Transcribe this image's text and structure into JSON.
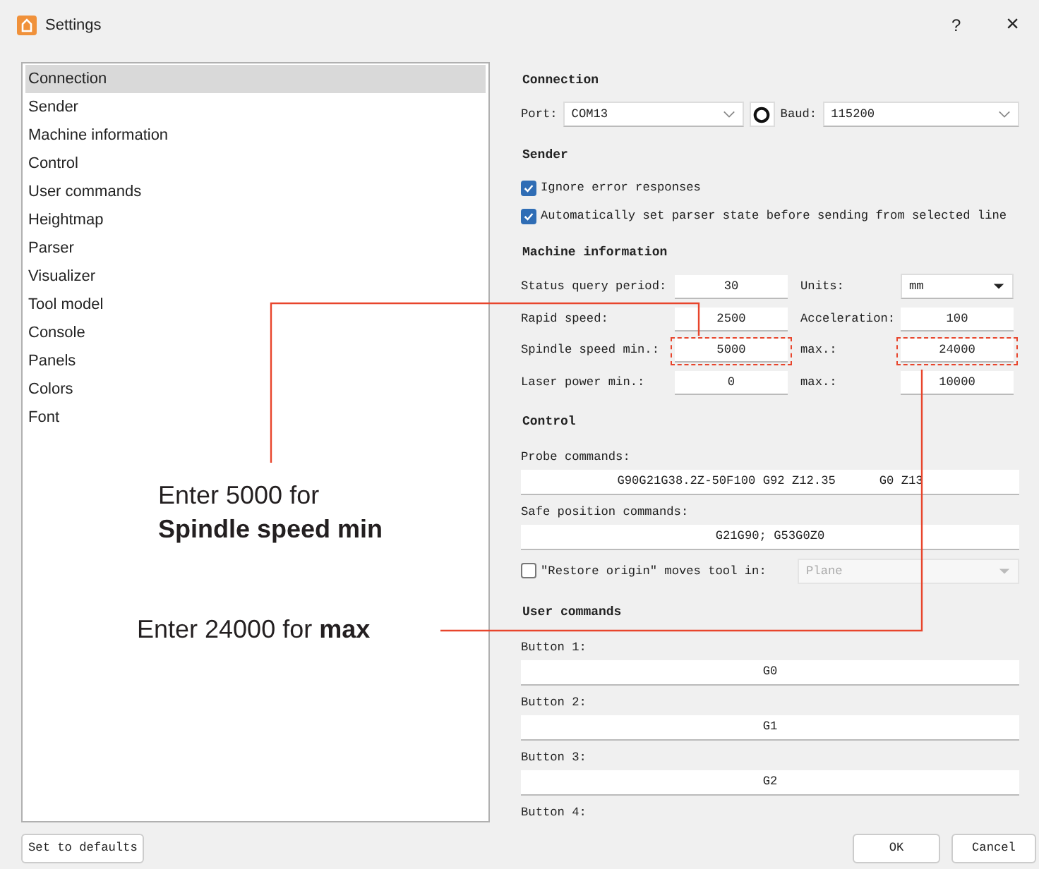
{
  "window": {
    "title": "Settings",
    "help": "?",
    "close": "×"
  },
  "sidebar": {
    "items": [
      {
        "label": "Connection",
        "selected": true
      },
      {
        "label": "Sender",
        "selected": false
      },
      {
        "label": "Machine information",
        "selected": false
      },
      {
        "label": "Control",
        "selected": false
      },
      {
        "label": "User commands",
        "selected": false
      },
      {
        "label": "Heightmap",
        "selected": false
      },
      {
        "label": "Parser",
        "selected": false
      },
      {
        "label": "Visualizer",
        "selected": false
      },
      {
        "label": "Tool model",
        "selected": false
      },
      {
        "label": "Console",
        "selected": false
      },
      {
        "label": "Panels",
        "selected": false
      },
      {
        "label": "Colors",
        "selected": false
      },
      {
        "label": "Font",
        "selected": false
      }
    ]
  },
  "connection": {
    "title": "Connection",
    "port_label": "Port:",
    "port": "COM13",
    "baud_label": "Baud:",
    "baud": "115200"
  },
  "sender": {
    "title": "Sender",
    "options": [
      {
        "label": "Ignore error responses",
        "checked": true
      },
      {
        "label": "Automatically set parser state before sending from selected line",
        "checked": true
      }
    ]
  },
  "machine_information": {
    "title": "Machine information",
    "rows": [
      {
        "kind": "dropdown",
        "label": "Status query period:",
        "value": "30",
        "label_2": "Units:",
        "value_2": "mm",
        "highlighted": false
      },
      {
        "kind": "field",
        "label": "Rapid speed:",
        "value": "2500",
        "label_2": "Acceleration:",
        "value_2": "100",
        "highlighted": false
      },
      {
        "kind": "field",
        "label": "Spindle speed min.:",
        "value": "5000",
        "label_2": "max.:",
        "value_2": "24000",
        "highlighted": true
      },
      {
        "kind": "field",
        "label": "Laser power min.:",
        "value": "0",
        "label_2": "max.:",
        "value_2": "10000",
        "highlighted": false
      }
    ]
  },
  "control": {
    "title": "Control",
    "probe_label": "Probe commands:",
    "probe": "G90G21G38.2Z-50F100 G92 Z12.35      G0 Z13",
    "safe_label": "Safe position commands:",
    "safe": "G21G90; G53G0Z0",
    "restore_label": "\"Restore origin\" moves tool in:",
    "restore_checked": false,
    "restore_value": "Plane"
  },
  "user_commands": {
    "title": "User commands",
    "buttons": [
      {
        "label": "Button 1:",
        "value": "G0"
      },
      {
        "label": "Button 2:",
        "value": "G1"
      },
      {
        "label": "Button 3:",
        "value": "G2"
      },
      {
        "label": "Button 4:"
      }
    ]
  },
  "callouts": [
    {
      "text": "Enter 5000 for **Spindle speed min**"
    },
    {
      "text": "Enter 24000 for **max**"
    }
  ],
  "buttons": {
    "defaults": "Set to defaults",
    "ok": "OK",
    "cancel": "Cancel"
  }
}
